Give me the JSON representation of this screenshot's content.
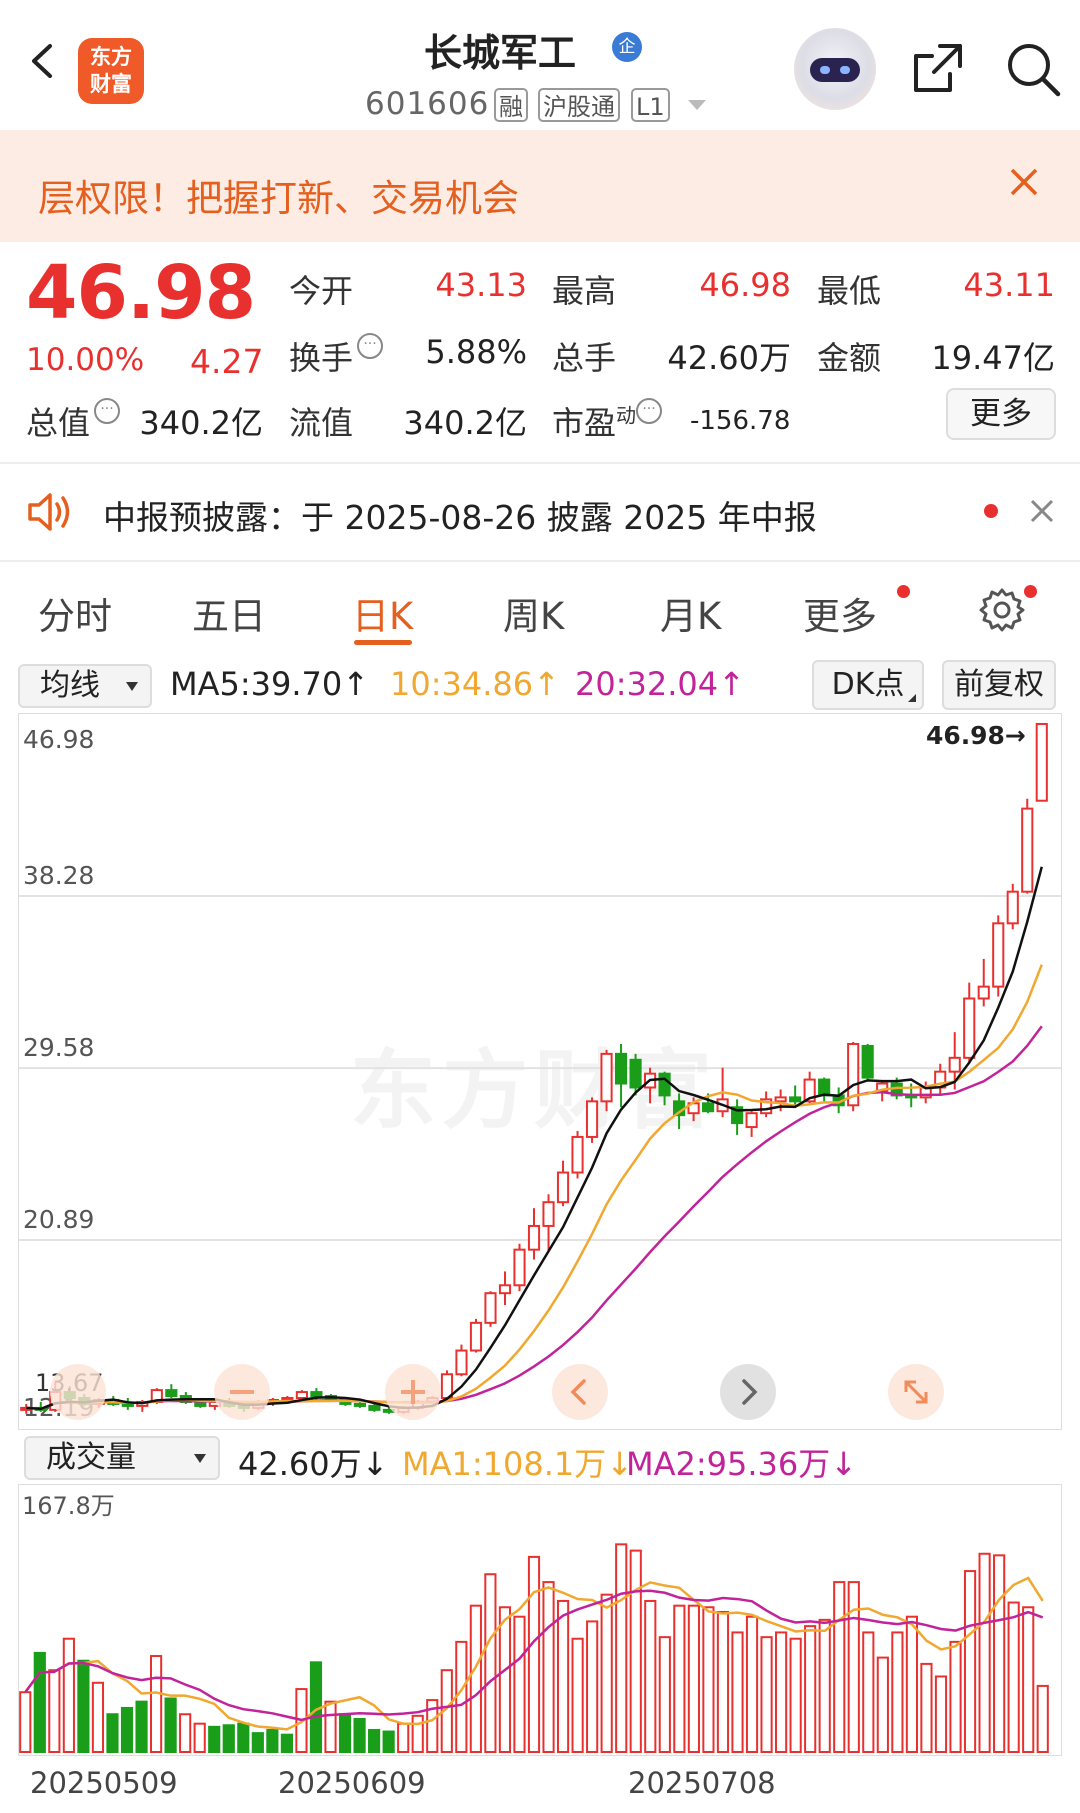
{
  "header": {
    "app_logo_line1": "东方",
    "app_logo_line2": "财富",
    "stock_name": "长城军工",
    "badge": "企",
    "code": "601606",
    "tags": [
      "融",
      "沪股通",
      "L1"
    ]
  },
  "banner": {
    "text": "层权限！把握打新、交易机会"
  },
  "quote": {
    "price": "46.98",
    "change_pct": "10.00%",
    "change": "4.27",
    "fields": {
      "open_label": "今开",
      "open": "43.13",
      "high_label": "最高",
      "high": "46.98",
      "low_label": "最低",
      "low": "43.11",
      "turnover_label": "换手",
      "turnover": "5.88%",
      "volume_label": "总手",
      "volume": "42.60万",
      "amount_label": "金额",
      "amount": "19.47亿",
      "mcap_label": "总值",
      "mcap": "340.2亿",
      "float_label": "流值",
      "float": "340.2亿",
      "pe_label": "市盈",
      "pe_sup": "动",
      "pe": "-156.78"
    },
    "more": "更多"
  },
  "notice": {
    "text": "中报预披露：于 2025-08-26 披露 2025 年中报"
  },
  "tabs": [
    {
      "label": "分时"
    },
    {
      "label": "五日"
    },
    {
      "label": "日K"
    },
    {
      "label": "周K"
    },
    {
      "label": "月K"
    },
    {
      "label": "更多"
    }
  ],
  "ma_bar": {
    "selector": "均线",
    "ma5": "MA5:39.70↑",
    "ma10": "10:34.86↑",
    "ma20": "20:32.04↑",
    "dk": "DK点",
    "adjust": "前复权"
  },
  "vol_bar": {
    "selector": "成交量",
    "vol": "42.60万↓",
    "ma1": "MA1:108.1万↓",
    "ma2": "MA2:95.36万↓"
  },
  "watermark": "东方财富",
  "colors": {
    "up": "#e8312f",
    "down": "#1a9e1a",
    "accent": "#e5601f",
    "ma5": "#111111",
    "ma10": "#f0a830",
    "ma20": "#c0239a"
  },
  "chart_data": {
    "type": "candlestick",
    "y_ticks": [
      "46.98",
      "38.28",
      "29.58",
      "20.89",
      "12.19"
    ],
    "ylim": [
      12.19,
      46.98
    ],
    "last_price_label": "46.98→",
    "left_marker_label": "13.67",
    "x_labels": [
      "20250509",
      "20250609",
      "20250708"
    ],
    "candles": [
      [
        12.3,
        12.6,
        12.1,
        12.4
      ],
      [
        12.4,
        12.7,
        12.2,
        12.3
      ],
      [
        12.3,
        13.7,
        12.2,
        13.2
      ],
      [
        13.2,
        13.5,
        12.8,
        12.9
      ],
      [
        12.9,
        13.1,
        12.5,
        12.6
      ],
      [
        12.6,
        12.9,
        12.4,
        12.8
      ],
      [
        12.8,
        13.0,
        12.5,
        12.6
      ],
      [
        12.6,
        12.9,
        12.3,
        12.5
      ],
      [
        12.5,
        12.8,
        12.2,
        12.7
      ],
      [
        12.7,
        13.4,
        12.6,
        13.3
      ],
      [
        13.3,
        13.6,
        12.9,
        13.0
      ],
      [
        13.0,
        13.2,
        12.6,
        12.7
      ],
      [
        12.7,
        12.9,
        12.4,
        12.5
      ],
      [
        12.5,
        12.8,
        12.3,
        12.7
      ],
      [
        12.7,
        12.9,
        12.4,
        12.5
      ],
      [
        12.5,
        12.7,
        12.2,
        12.4
      ],
      [
        12.4,
        12.8,
        12.3,
        12.7
      ],
      [
        12.7,
        12.9,
        12.5,
        12.8
      ],
      [
        12.8,
        13.0,
        12.6,
        12.9
      ],
      [
        12.9,
        13.3,
        12.7,
        13.2
      ],
      [
        13.2,
        13.4,
        12.8,
        13.0
      ],
      [
        13.0,
        13.1,
        12.7,
        12.8
      ],
      [
        12.8,
        12.9,
        12.5,
        12.6
      ],
      [
        12.6,
        12.8,
        12.4,
        12.5
      ],
      [
        12.5,
        12.7,
        12.2,
        12.3
      ],
      [
        12.3,
        12.5,
        12.1,
        12.2
      ],
      [
        12.2,
        12.5,
        12.1,
        12.4
      ],
      [
        12.4,
        12.8,
        12.3,
        12.7
      ],
      [
        12.7,
        13.0,
        12.6,
        12.9
      ],
      [
        12.9,
        14.3,
        12.8,
        14.1
      ],
      [
        14.1,
        15.6,
        14.0,
        15.3
      ],
      [
        15.3,
        16.9,
        15.2,
        16.7
      ],
      [
        16.7,
        18.3,
        16.5,
        18.2
      ],
      [
        18.2,
        19.3,
        17.6,
        18.6
      ],
      [
        18.6,
        20.7,
        18.3,
        20.4
      ],
      [
        20.4,
        22.5,
        19.9,
        21.6
      ],
      [
        21.6,
        23.2,
        20.3,
        22.8
      ],
      [
        22.8,
        24.9,
        22.6,
        24.3
      ],
      [
        24.3,
        26.4,
        24.0,
        26.1
      ],
      [
        26.1,
        28.1,
        25.8,
        27.9
      ],
      [
        27.9,
        30.5,
        27.4,
        30.3
      ],
      [
        30.3,
        30.8,
        27.6,
        28.8
      ],
      [
        30.0,
        30.3,
        28.2,
        28.6
      ],
      [
        28.6,
        29.6,
        27.8,
        29.3
      ],
      [
        29.3,
        29.4,
        27.7,
        28.2
      ],
      [
        27.9,
        28.3,
        26.5,
        27.2
      ],
      [
        27.3,
        28.1,
        26.9,
        27.8
      ],
      [
        27.8,
        28.3,
        27.3,
        27.4
      ],
      [
        27.4,
        29.6,
        27.1,
        28.0
      ],
      [
        27.6,
        28.0,
        26.2,
        26.8
      ],
      [
        26.6,
        27.4,
        26.1,
        27.3
      ],
      [
        27.3,
        28.4,
        27.1,
        28.0
      ],
      [
        27.9,
        28.5,
        27.4,
        28.1
      ],
      [
        28.1,
        28.7,
        27.6,
        27.9
      ],
      [
        27.9,
        29.4,
        27.8,
        29.0
      ],
      [
        29.0,
        29.1,
        27.9,
        28.2
      ],
      [
        28.2,
        28.6,
        27.3,
        27.7
      ],
      [
        27.7,
        30.9,
        27.4,
        30.8
      ],
      [
        30.7,
        30.8,
        29.0,
        29.1
      ],
      [
        28.4,
        28.9,
        27.9,
        28.8
      ],
      [
        28.8,
        29.1,
        28.0,
        28.2
      ],
      [
        28.2,
        28.8,
        27.6,
        28.1
      ],
      [
        28.1,
        28.9,
        27.8,
        28.6
      ],
      [
        28.6,
        29.8,
        28.2,
        29.4
      ],
      [
        29.4,
        31.4,
        28.5,
        30.1
      ],
      [
        30.1,
        33.9,
        29.8,
        33.1
      ],
      [
        33.1,
        35.1,
        32.7,
        33.7
      ],
      [
        33.7,
        37.3,
        33.2,
        36.9
      ],
      [
        36.9,
        38.9,
        36.6,
        38.5
      ],
      [
        38.5,
        43.2,
        38.4,
        42.7
      ],
      [
        43.1,
        46.98,
        43.11,
        46.98
      ]
    ],
    "ma5_end": 39.7,
    "ma10_end": 34.86,
    "ma20_end": 32.04,
    "volume_max_label": "167.8万",
    "volumes": [
      [
        38,
        1
      ],
      [
        63,
        0
      ],
      [
        52,
        1
      ],
      [
        72,
        1
      ],
      [
        58,
        0
      ],
      [
        44,
        1
      ],
      [
        24,
        0
      ],
      [
        28,
        0
      ],
      [
        32,
        0
      ],
      [
        61,
        1
      ],
      [
        34,
        0
      ],
      [
        24,
        1
      ],
      [
        18,
        1
      ],
      [
        16,
        0
      ],
      [
        17,
        0
      ],
      [
        18,
        0
      ],
      [
        12,
        0
      ],
      [
        14,
        0
      ],
      [
        11,
        0
      ],
      [
        40,
        1
      ],
      [
        57,
        0
      ],
      [
        32,
        1
      ],
      [
        24,
        0
      ],
      [
        21,
        0
      ],
      [
        14,
        0
      ],
      [
        13,
        0
      ],
      [
        18,
        1
      ],
      [
        23,
        1
      ],
      [
        33,
        1
      ],
      [
        52,
        1
      ],
      [
        70,
        1
      ],
      [
        93,
        1
      ],
      [
        113,
        1
      ],
      [
        92,
        1
      ],
      [
        86,
        1
      ],
      [
        124,
        1
      ],
      [
        108,
        1
      ],
      [
        96,
        1
      ],
      [
        72,
        1
      ],
      [
        83,
        1
      ],
      [
        100,
        1
      ],
      [
        132,
        1
      ],
      [
        128,
        1
      ],
      [
        96,
        1
      ],
      [
        73,
        1
      ],
      [
        93,
        1
      ],
      [
        93,
        1
      ],
      [
        92,
        1
      ],
      [
        89,
        1
      ],
      [
        76,
        1
      ],
      [
        86,
        1
      ],
      [
        73,
        1
      ],
      [
        76,
        1
      ],
      [
        72,
        1
      ],
      [
        80,
        1
      ],
      [
        84,
        1
      ],
      [
        108,
        1
      ],
      [
        108,
        1
      ],
      [
        76,
        1
      ],
      [
        60,
        1
      ],
      [
        76,
        1
      ],
      [
        86,
        1
      ],
      [
        56,
        1
      ],
      [
        48,
        1
      ],
      [
        70,
        1
      ],
      [
        115,
        1
      ],
      [
        126,
        1
      ],
      [
        125,
        1
      ],
      [
        95,
        1
      ],
      [
        92,
        1
      ],
      [
        42,
        1
      ]
    ]
  }
}
